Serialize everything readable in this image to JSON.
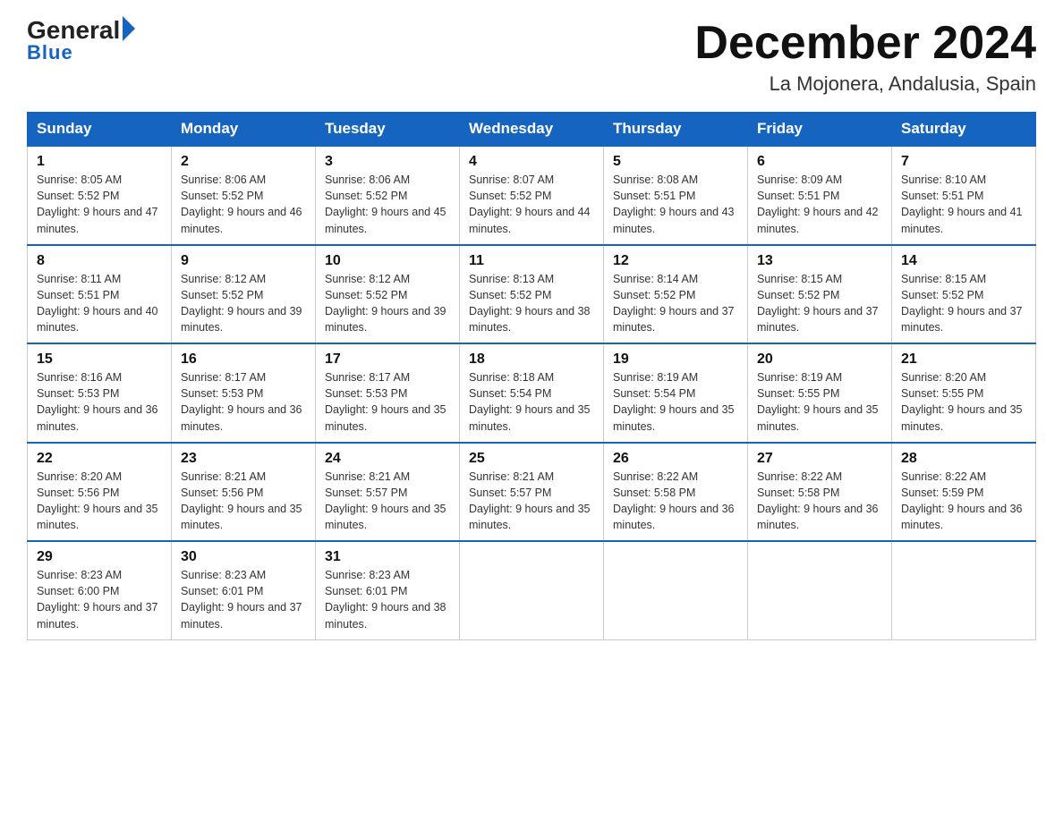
{
  "logo": {
    "general": "General",
    "blue": "Blue",
    "underline": "Blue"
  },
  "title": {
    "month": "December 2024",
    "location": "La Mojonera, Andalusia, Spain"
  },
  "headers": [
    "Sunday",
    "Monday",
    "Tuesday",
    "Wednesday",
    "Thursday",
    "Friday",
    "Saturday"
  ],
  "weeks": [
    [
      {
        "day": "1",
        "sunrise": "8:05 AM",
        "sunset": "5:52 PM",
        "daylight": "9 hours and 47 minutes."
      },
      {
        "day": "2",
        "sunrise": "8:06 AM",
        "sunset": "5:52 PM",
        "daylight": "9 hours and 46 minutes."
      },
      {
        "day": "3",
        "sunrise": "8:06 AM",
        "sunset": "5:52 PM",
        "daylight": "9 hours and 45 minutes."
      },
      {
        "day": "4",
        "sunrise": "8:07 AM",
        "sunset": "5:52 PM",
        "daylight": "9 hours and 44 minutes."
      },
      {
        "day": "5",
        "sunrise": "8:08 AM",
        "sunset": "5:51 PM",
        "daylight": "9 hours and 43 minutes."
      },
      {
        "day": "6",
        "sunrise": "8:09 AM",
        "sunset": "5:51 PM",
        "daylight": "9 hours and 42 minutes."
      },
      {
        "day": "7",
        "sunrise": "8:10 AM",
        "sunset": "5:51 PM",
        "daylight": "9 hours and 41 minutes."
      }
    ],
    [
      {
        "day": "8",
        "sunrise": "8:11 AM",
        "sunset": "5:51 PM",
        "daylight": "9 hours and 40 minutes."
      },
      {
        "day": "9",
        "sunrise": "8:12 AM",
        "sunset": "5:52 PM",
        "daylight": "9 hours and 39 minutes."
      },
      {
        "day": "10",
        "sunrise": "8:12 AM",
        "sunset": "5:52 PM",
        "daylight": "9 hours and 39 minutes."
      },
      {
        "day": "11",
        "sunrise": "8:13 AM",
        "sunset": "5:52 PM",
        "daylight": "9 hours and 38 minutes."
      },
      {
        "day": "12",
        "sunrise": "8:14 AM",
        "sunset": "5:52 PM",
        "daylight": "9 hours and 37 minutes."
      },
      {
        "day": "13",
        "sunrise": "8:15 AM",
        "sunset": "5:52 PM",
        "daylight": "9 hours and 37 minutes."
      },
      {
        "day": "14",
        "sunrise": "8:15 AM",
        "sunset": "5:52 PM",
        "daylight": "9 hours and 37 minutes."
      }
    ],
    [
      {
        "day": "15",
        "sunrise": "8:16 AM",
        "sunset": "5:53 PM",
        "daylight": "9 hours and 36 minutes."
      },
      {
        "day": "16",
        "sunrise": "8:17 AM",
        "sunset": "5:53 PM",
        "daylight": "9 hours and 36 minutes."
      },
      {
        "day": "17",
        "sunrise": "8:17 AM",
        "sunset": "5:53 PM",
        "daylight": "9 hours and 35 minutes."
      },
      {
        "day": "18",
        "sunrise": "8:18 AM",
        "sunset": "5:54 PM",
        "daylight": "9 hours and 35 minutes."
      },
      {
        "day": "19",
        "sunrise": "8:19 AM",
        "sunset": "5:54 PM",
        "daylight": "9 hours and 35 minutes."
      },
      {
        "day": "20",
        "sunrise": "8:19 AM",
        "sunset": "5:55 PM",
        "daylight": "9 hours and 35 minutes."
      },
      {
        "day": "21",
        "sunrise": "8:20 AM",
        "sunset": "5:55 PM",
        "daylight": "9 hours and 35 minutes."
      }
    ],
    [
      {
        "day": "22",
        "sunrise": "8:20 AM",
        "sunset": "5:56 PM",
        "daylight": "9 hours and 35 minutes."
      },
      {
        "day": "23",
        "sunrise": "8:21 AM",
        "sunset": "5:56 PM",
        "daylight": "9 hours and 35 minutes."
      },
      {
        "day": "24",
        "sunrise": "8:21 AM",
        "sunset": "5:57 PM",
        "daylight": "9 hours and 35 minutes."
      },
      {
        "day": "25",
        "sunrise": "8:21 AM",
        "sunset": "5:57 PM",
        "daylight": "9 hours and 35 minutes."
      },
      {
        "day": "26",
        "sunrise": "8:22 AM",
        "sunset": "5:58 PM",
        "daylight": "9 hours and 36 minutes."
      },
      {
        "day": "27",
        "sunrise": "8:22 AM",
        "sunset": "5:58 PM",
        "daylight": "9 hours and 36 minutes."
      },
      {
        "day": "28",
        "sunrise": "8:22 AM",
        "sunset": "5:59 PM",
        "daylight": "9 hours and 36 minutes."
      }
    ],
    [
      {
        "day": "29",
        "sunrise": "8:23 AM",
        "sunset": "6:00 PM",
        "daylight": "9 hours and 37 minutes."
      },
      {
        "day": "30",
        "sunrise": "8:23 AM",
        "sunset": "6:01 PM",
        "daylight": "9 hours and 37 minutes."
      },
      {
        "day": "31",
        "sunrise": "8:23 AM",
        "sunset": "6:01 PM",
        "daylight": "9 hours and 38 minutes."
      },
      null,
      null,
      null,
      null
    ]
  ]
}
